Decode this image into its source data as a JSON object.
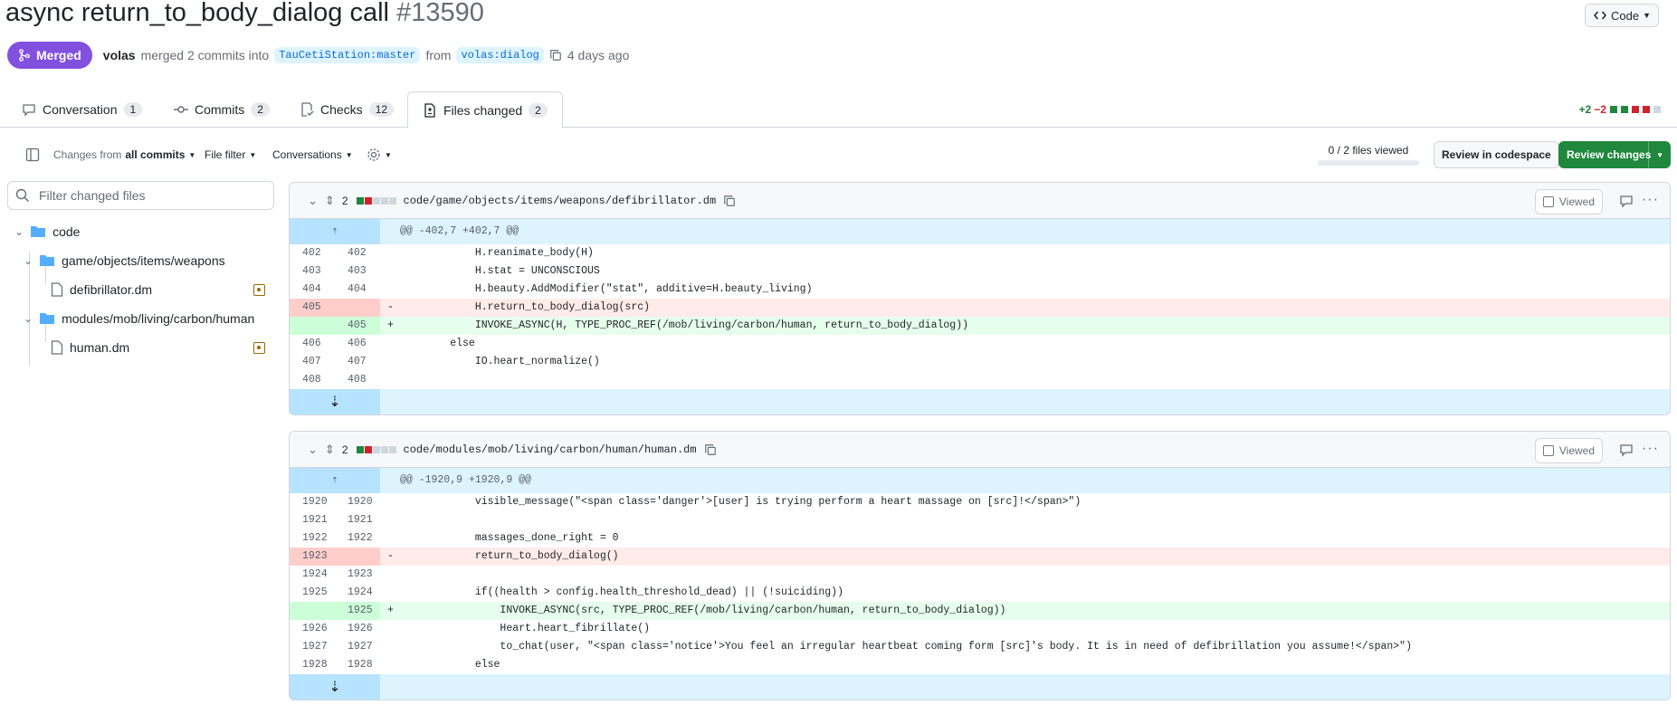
{
  "pr": {
    "title": "async return_to_body_dialog call",
    "number": "#13590",
    "status": "Merged",
    "author": "volas",
    "merged_text": "merged 2 commits into",
    "base_branch": "TauCetiStation:master",
    "from_text": "from",
    "head_branch": "volas:dialog",
    "time": "4 days ago",
    "code_button": "Code"
  },
  "tabs": [
    {
      "label": "Conversation",
      "count": "1",
      "icon": "comment-icon"
    },
    {
      "label": "Commits",
      "count": "2",
      "icon": "commit-icon"
    },
    {
      "label": "Checks",
      "count": "12",
      "icon": "checklist-icon"
    },
    {
      "label": "Files changed",
      "count": "2",
      "icon": "file-diff-icon"
    }
  ],
  "diffstat": {
    "additions": "+2",
    "deletions": "−2"
  },
  "toolbar": {
    "changes_from_prefix": "Changes from",
    "changes_from_value": "all commits",
    "file_filter": "File filter",
    "conversations": "Conversations",
    "files_viewed": "0 / 2 files viewed",
    "codespace_button": "Review in codespace",
    "review_button": "Review changes"
  },
  "sidebar": {
    "filter_placeholder": "Filter changed files",
    "tree": [
      {
        "type": "folder",
        "label": "code"
      },
      {
        "type": "folder",
        "label": "game/objects/items/weapons"
      },
      {
        "type": "file",
        "label": "defibrillator.dm"
      },
      {
        "type": "folder",
        "label": "modules/mob/living/carbon/human"
      },
      {
        "type": "file",
        "label": "human.dm"
      }
    ]
  },
  "files": [
    {
      "changes": "2",
      "path": "code/game/objects/items/weapons/defibrillator.dm",
      "viewed_label": "Viewed",
      "hunk": "@@ -402,7 +402,7 @@",
      "lines": [
        {
          "old": "402",
          "new": "402",
          "sign": "",
          "type": "ctx",
          "text": "            H.reanimate_body(H)"
        },
        {
          "old": "403",
          "new": "403",
          "sign": "",
          "type": "ctx",
          "text": "            H.stat = UNCONSCIOUS"
        },
        {
          "old": "404",
          "new": "404",
          "sign": "",
          "type": "ctx",
          "text": "            H.beauty.AddModifier(\"stat\", additive=H.beauty_living)"
        },
        {
          "old": "405",
          "new": "",
          "sign": "-",
          "type": "del",
          "text": "            H.return_to_body_dialog(src)"
        },
        {
          "old": "",
          "new": "405",
          "sign": "+",
          "type": "add",
          "text": "            INVOKE_ASYNC(H, TYPE_PROC_REF(/mob/living/carbon/human, return_to_body_dialog))"
        },
        {
          "old": "406",
          "new": "406",
          "sign": "",
          "type": "ctx",
          "text": "        else"
        },
        {
          "old": "407",
          "new": "407",
          "sign": "",
          "type": "ctx",
          "text": "            IO.heart_normalize()"
        },
        {
          "old": "408",
          "new": "408",
          "sign": "",
          "type": "ctx",
          "text": ""
        }
      ]
    },
    {
      "changes": "2",
      "path": "code/modules/mob/living/carbon/human/human.dm",
      "viewed_label": "Viewed",
      "hunk": "@@ -1920,9 +1920,9 @@",
      "lines": [
        {
          "old": "1920",
          "new": "1920",
          "sign": "",
          "type": "ctx",
          "text": "            visible_message(\"<span class='danger'>[user] is trying perform a heart massage on [src]!</span>\")"
        },
        {
          "old": "1921",
          "new": "1921",
          "sign": "",
          "type": "ctx",
          "text": ""
        },
        {
          "old": "1922",
          "new": "1922",
          "sign": "",
          "type": "ctx",
          "text": "            massages_done_right = 0"
        },
        {
          "old": "1923",
          "new": "",
          "sign": "-",
          "type": "del",
          "text": "            return_to_body_dialog()"
        },
        {
          "old": "1924",
          "new": "1923",
          "sign": "",
          "type": "ctx",
          "text": ""
        },
        {
          "old": "1925",
          "new": "1924",
          "sign": "",
          "type": "ctx",
          "text": "            if((health > config.health_threshold_dead) || (!suiciding))"
        },
        {
          "old": "",
          "new": "1925",
          "sign": "+",
          "type": "add",
          "text": "                INVOKE_ASYNC(src, TYPE_PROC_REF(/mob/living/carbon/human, return_to_body_dialog))"
        },
        {
          "old": "1926",
          "new": "1926",
          "sign": "",
          "type": "ctx",
          "text": "                Heart.heart_fibrillate()"
        },
        {
          "old": "1927",
          "new": "1927",
          "sign": "",
          "type": "ctx",
          "text": "                to_chat(user, \"<span class='notice'>You feel an irregular heartbeat coming form [src]'s body. It is in need of defibrillation you assume!</span>\")"
        },
        {
          "old": "1928",
          "new": "1928",
          "sign": "",
          "type": "ctx",
          "text": "            else"
        }
      ]
    }
  ]
}
